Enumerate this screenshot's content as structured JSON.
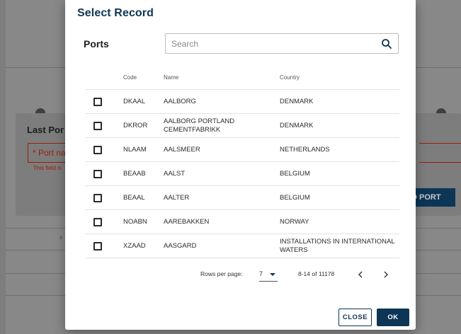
{
  "background": {
    "dialog_title": "Last Por",
    "port_field_value": "* Port na",
    "error_text": "This field is",
    "add_button_label": "D PORT"
  },
  "modal": {
    "title": "Select Record",
    "section_label": "Ports",
    "search": {
      "placeholder": "Search",
      "value": ""
    },
    "columns": {
      "code": "Code",
      "name": "Name",
      "country": "Country"
    },
    "rows": [
      {
        "code": "DKAAL",
        "name": "AALBORG",
        "country": "DENMARK"
      },
      {
        "code": "DKROR",
        "name": "AALBORG PORTLAND CEMENTFABRIKK",
        "country": "DENMARK"
      },
      {
        "code": "NLAAM",
        "name": "AALSMEER",
        "country": "NETHERLANDS"
      },
      {
        "code": "BEAAB",
        "name": "AALST",
        "country": "BELGIUM"
      },
      {
        "code": "BEAAL",
        "name": "AALTER",
        "country": "BELGIUM"
      },
      {
        "code": "NOABN",
        "name": "AAREBAKKEN",
        "country": "NORWAY"
      },
      {
        "code": "XZAAD",
        "name": "AASGARD",
        "country": "INSTALLATIONS IN INTERNATIONAL WATERS"
      }
    ],
    "pagination": {
      "rows_per_page_label": "Rows per page:",
      "rows_per_page_value": "7",
      "range_text": "8-14 of 11178"
    },
    "buttons": {
      "close": "CLOSE",
      "ok": "OK"
    }
  },
  "colors": {
    "primary": "#0d3656",
    "error": "#9a1e0b",
    "overlay": "#7d7d7d"
  }
}
